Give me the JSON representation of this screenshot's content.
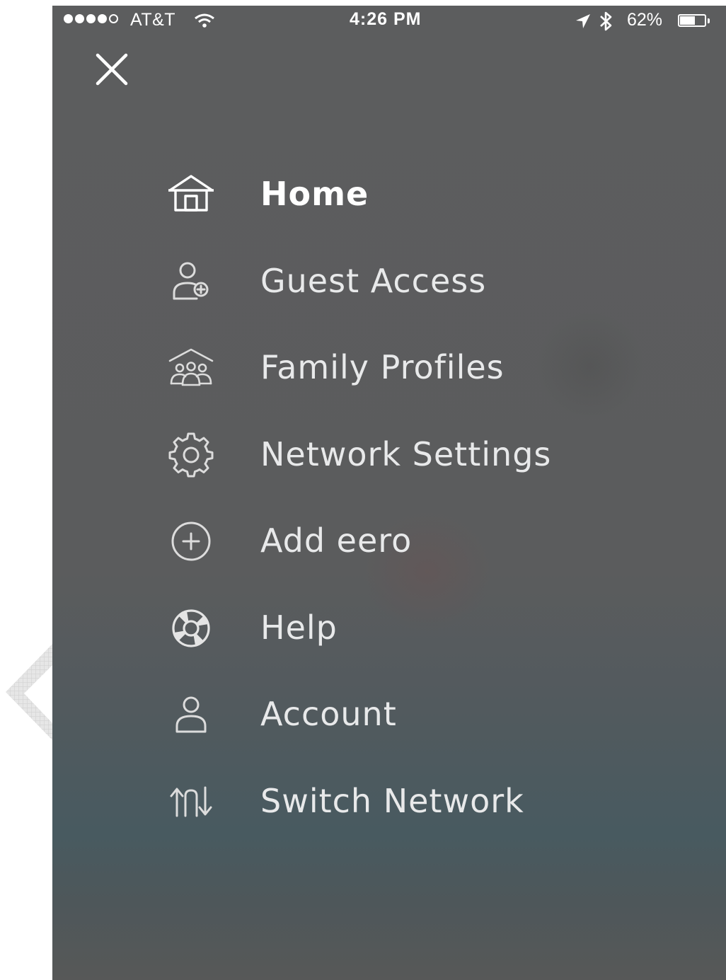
{
  "status_bar": {
    "carrier": "AT&T",
    "time": "4:26 PM",
    "battery_percent": "62%",
    "battery_level": 0.62,
    "signal_bars_filled": 4,
    "signal_bars_total": 5,
    "icons": [
      "signal-dots-icon",
      "wifi-icon",
      "location-arrow-icon",
      "bluetooth-icon",
      "battery-icon"
    ]
  },
  "header": {
    "close_icon": "close-icon"
  },
  "menu": {
    "items": [
      {
        "label": "Home",
        "icon": "home-icon",
        "active": true
      },
      {
        "label": "Guest Access",
        "icon": "guest-user-add-icon",
        "active": false
      },
      {
        "label": "Family Profiles",
        "icon": "family-profiles-icon",
        "active": false
      },
      {
        "label": "Network Settings",
        "icon": "gear-icon",
        "active": false
      },
      {
        "label": "Add eero",
        "icon": "add-circle-icon",
        "active": false
      },
      {
        "label": "Help",
        "icon": "lifebuoy-icon",
        "active": false
      },
      {
        "label": "Account",
        "icon": "user-icon",
        "active": false
      },
      {
        "label": "Switch Network",
        "icon": "switch-arrows-icon",
        "active": false
      }
    ]
  },
  "colors": {
    "overlay_top": "#5c5d5e",
    "overlay_bottom": "#485a60",
    "text_primary": "#ffffff",
    "text_secondary": "#e8e9ea"
  }
}
